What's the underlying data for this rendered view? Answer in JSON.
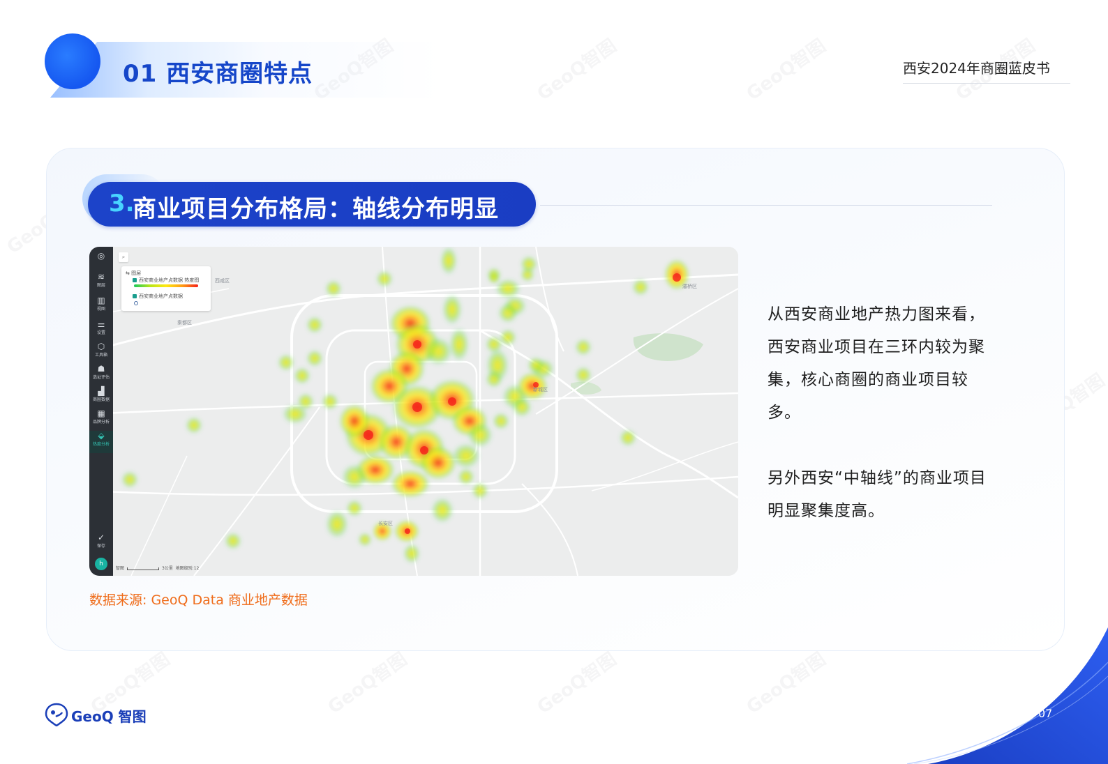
{
  "header": {
    "section_title": "01 西安商圈特点",
    "report_title": "西安2024年商圈蓝皮书"
  },
  "card": {
    "heading_number": "3.",
    "heading_text": "商业项目分布格局：轴线分布明显"
  },
  "map": {
    "sidebar": [
      {
        "label": "图层",
        "icon": "layers-icon"
      },
      {
        "label": "视图",
        "icon": "books-icon"
      },
      {
        "label": "设置",
        "icon": "sliders-icon"
      },
      {
        "label": "工具箱",
        "icon": "cube-icon"
      },
      {
        "label": "选址评估",
        "icon": "location-person-icon"
      },
      {
        "label": "商圈数据",
        "icon": "bar-chart-icon"
      },
      {
        "label": "品牌分析",
        "icon": "grid-icon"
      },
      {
        "label": "热度分析",
        "icon": "heat-icon"
      },
      {
        "label": "保存",
        "icon": "check-circle-icon"
      }
    ],
    "avatar_letter": "h",
    "legend": {
      "header": "图层",
      "layer_heat": "西安商业地产点数据 热度图",
      "layer_points": "西安商业地产点数据"
    },
    "scale_left": "智图",
    "scale_text": "3公里",
    "zoom_text": "地图级别:12",
    "district_label": "长安区",
    "heat_colors": [
      "#19c95d",
      "#b8e619",
      "#ffe812",
      "#ff9d14",
      "#f5201a"
    ]
  },
  "source": "数据来源: GeoQ Data 商业地产数据",
  "description": {
    "paragraph1": "从西安商业地产热力图来看，西安商业项目在三环内较为聚集，核心商圈的商业项目较多。",
    "paragraph2": "另外西安“中轴线”的商业项目明显聚集度高。"
  },
  "footer": {
    "brand": "GeoQ 智图",
    "page_number": "07",
    "watermark": "GeoQ智图"
  },
  "colors": {
    "primary": "#1c43c9",
    "accent": "#48d4ff",
    "source": "#ef6c1a"
  }
}
